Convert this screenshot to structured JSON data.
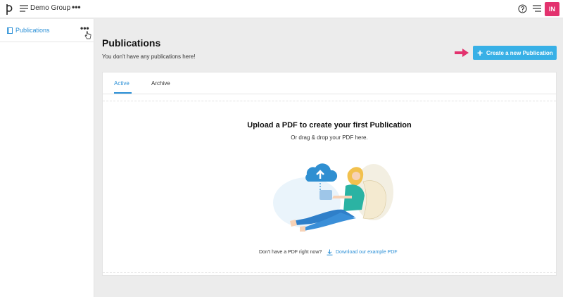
{
  "app": {
    "group_name": "Demo Group",
    "more_symbol": "•••",
    "avatar_initials": "IN",
    "brand_color": "#e3326e",
    "accent_color": "#38b0e6"
  },
  "sidebar": {
    "items": [
      {
        "label": "Publications",
        "icon": "book-icon",
        "more_symbol": "•••"
      }
    ]
  },
  "main": {
    "title": "Publications",
    "subtitle": "You don't have any publications here!",
    "create_button": {
      "plus": "+",
      "label": "Create a new Publication"
    },
    "tabs": [
      {
        "label": "Active",
        "active": true
      },
      {
        "label": "Archive",
        "active": false
      }
    ],
    "upload": {
      "title": "Upload a PDF to create your first Publication",
      "subtitle": "Or drag & drop your PDF here.",
      "footer_text": "Don't have a PDF right now?",
      "download_link": "Download our example PDF"
    }
  }
}
